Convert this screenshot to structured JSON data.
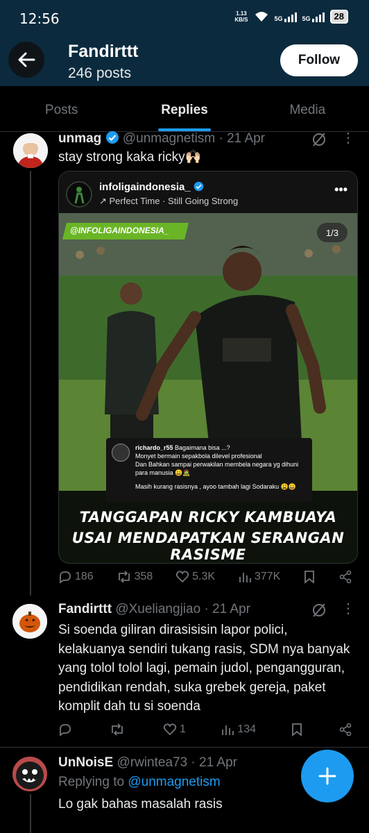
{
  "status_bar": {
    "time": "12:56",
    "speed_value": "1.13",
    "speed_unit": "KB/S",
    "sim1": "5G",
    "sim2": "5G",
    "battery": "28"
  },
  "header": {
    "name": "Fandirttt",
    "posts": "246 posts",
    "follow_label": "Follow"
  },
  "tabs": [
    {
      "label": "Posts"
    },
    {
      "label": "Replies"
    },
    {
      "label": "Media"
    }
  ],
  "tweets": [
    {
      "name": "unmag",
      "handle": "@unmagnetism",
      "date": "· 21 Apr",
      "text": "stay strong kaka ricky🙌🏻",
      "embed": {
        "user": "infoligaindonesia_",
        "subtitle": "↗ Perfect Time · Still Going Strong",
        "tag": "@INFOLIGAINDONESIA_",
        "counter": "1/3",
        "comment_user": "richardo_r55",
        "comment_line1": "Bagaimana bisa ...?",
        "comment_line2": "Monyet bermain sepakbola dilevel profesional",
        "comment_line3": "Dan Bahkan sampai perwakilan membela negara yg dihuni",
        "comment_line4": "para manusia 😀🧟",
        "comment_line5": "Masih kurang rasisnya , ayoo tambah lagi Sodaraku 😩😀",
        "headline1": "TANGGAPAN RICKY KAMBUAYA",
        "headline2": "USAI MENDAPATKAN SERANGAN RASISME"
      },
      "replies": "186",
      "reposts": "358",
      "likes": "5.3K",
      "views": "377K"
    },
    {
      "name": "Fandirttt",
      "handle": "@Xueliangjiao",
      "date": "· 21 Apr",
      "text": "Si soenda giliran dirasisisin lapor polici, kelakuanya sendiri tukang rasis, SDM nya banyak yang tolol tolol lagi, pemain judol, pengangguran, pendidikan rendah, suka grebek gereja, paket komplit dah tu si soenda",
      "replies": "",
      "reposts": "",
      "likes": "1",
      "views": "134"
    },
    {
      "name": "UnNoisE",
      "handle": "@rwintea73",
      "date": "· 21 Apr",
      "replying_prefix": "Replying to",
      "replying_to": "@unmagnetism",
      "text": "Lo gak bahas masalah rasis"
    }
  ],
  "colors": {
    "accent": "#1d9bf0",
    "header_bg": "#0b2a3d",
    "background": "#000000",
    "muted": "#71767b"
  },
  "icons": [
    "back-arrow-icon",
    "verified-icon",
    "grok-icon",
    "reply-icon",
    "repost-icon",
    "like-icon",
    "views-icon",
    "bookmark-icon",
    "share-icon",
    "compose-plus-icon",
    "more-icon"
  ]
}
